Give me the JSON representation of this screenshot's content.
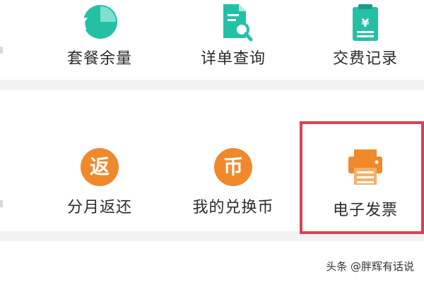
{
  "services": {
    "row1": [
      {
        "label": "套餐余量",
        "icon": "clock-icon"
      },
      {
        "label": "详单查询",
        "icon": "document-search-icon"
      },
      {
        "label": "交费记录",
        "icon": "bill-clipboard-icon"
      }
    ],
    "row2": [
      {
        "label": "分月返还",
        "icon": "rebate-badge-icon",
        "badge": "返"
      },
      {
        "label": "我的兑换币",
        "icon": "coin-badge-icon",
        "badge": "币"
      },
      {
        "label": "电子发票",
        "icon": "printer-icon"
      }
    ]
  },
  "watermark": "头条 @胖辉有话说",
  "colors": {
    "teal": "#24c0a6",
    "orange": "#f0892c",
    "highlight_border": "#d84157",
    "background": "#f2f2f2"
  }
}
